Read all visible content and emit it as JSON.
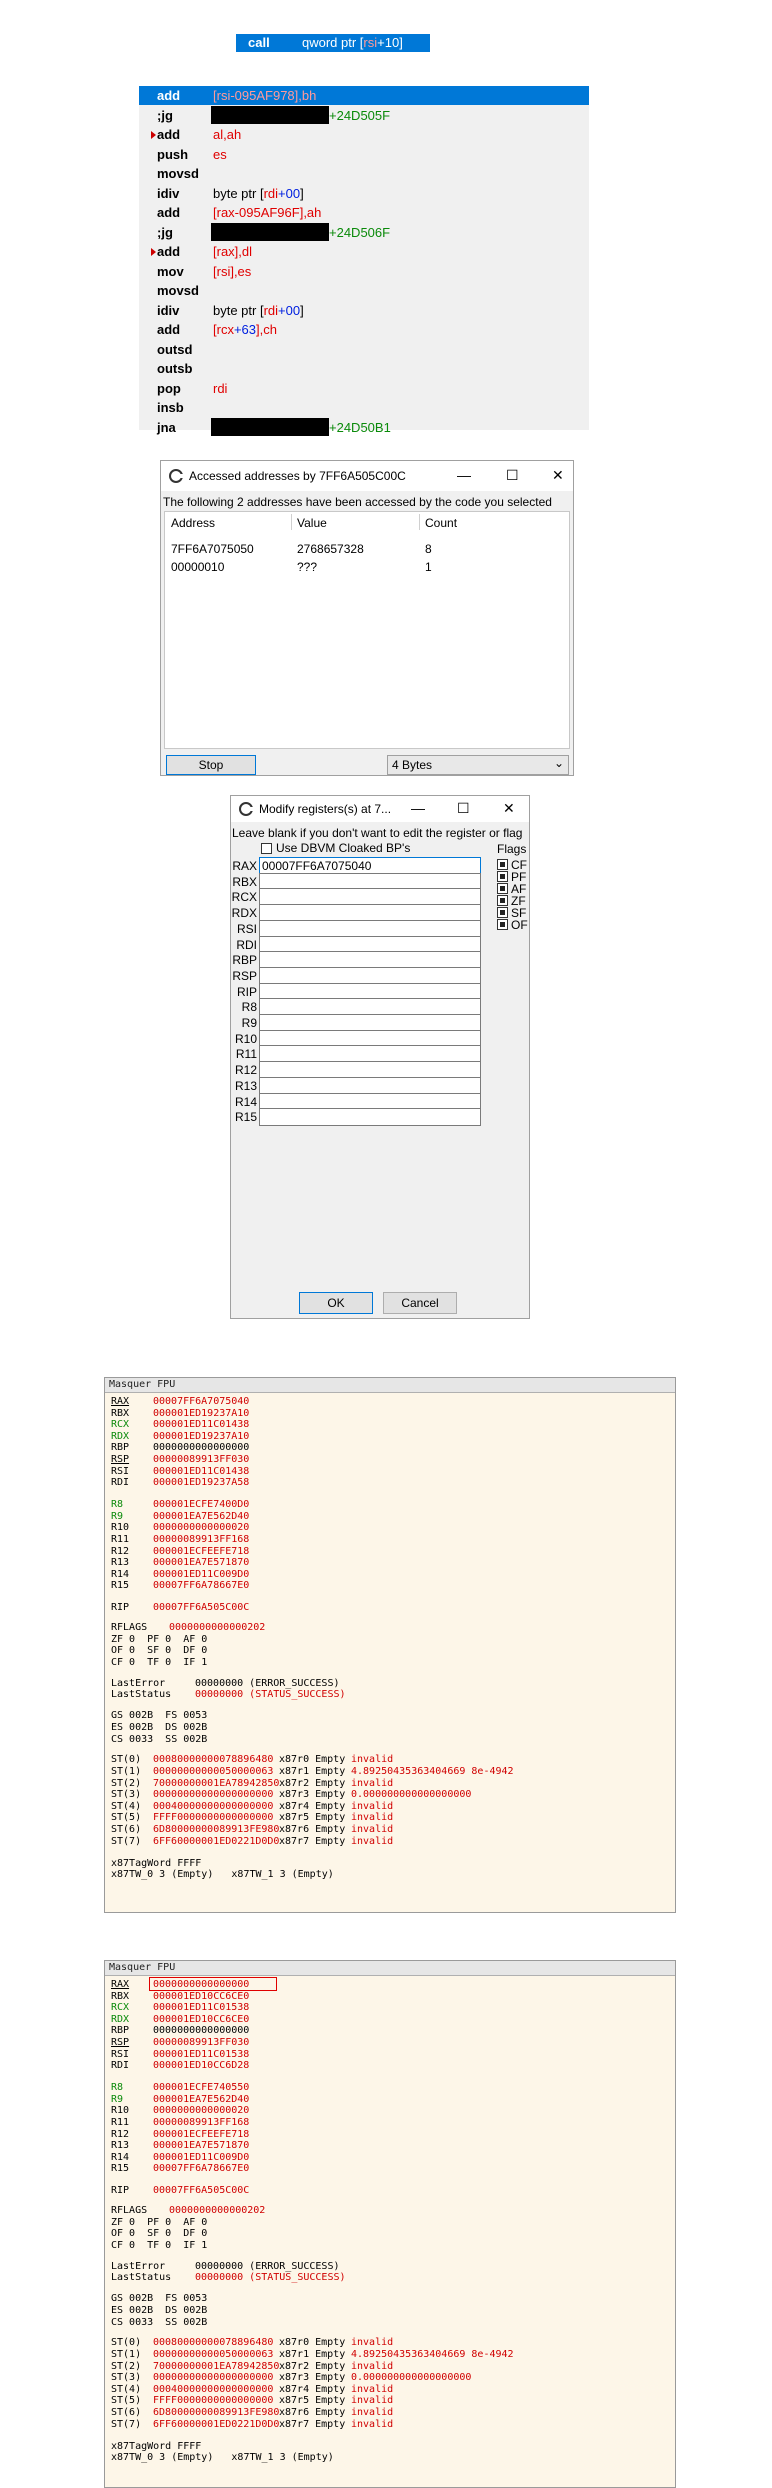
{
  "call_line": {
    "mnemonic": "call",
    "operand_prefix": "qword ptr [",
    "operand_reg": "rsi",
    "operand_plus": "+",
    "operand_off": "10",
    "operand_suffix": "]"
  },
  "disasm": [
    {
      "mn": "add",
      "ops": [
        [
          "red",
          "[rsi-095AF978],"
        ],
        [
          "red",
          "bh"
        ]
      ],
      "selected": true
    },
    {
      "mn": ";jg",
      "redacted": true,
      "target": "+24D505F",
      "arrow": false
    },
    {
      "mn": "add",
      "ops": [
        [
          "red",
          "al,ah"
        ]
      ],
      "arrow": true
    },
    {
      "mn": "push",
      "ops": [
        [
          "red",
          "es"
        ]
      ]
    },
    {
      "mn": "movsd",
      "ops": []
    },
    {
      "mn": "idiv",
      "ops": [
        [
          "",
          "byte ptr ["
        ],
        [
          "red",
          "rdi"
        ],
        [
          "blue",
          "+00"
        ],
        [
          "",
          "]"
        ]
      ]
    },
    {
      "mn": "add",
      "ops": [
        [
          "red",
          "[rax-095AF96F],ah"
        ]
      ]
    },
    {
      "mn": ";jg",
      "redacted": true,
      "target": "+24D506F"
    },
    {
      "mn": "add",
      "ops": [
        [
          "red",
          "[rax],dl"
        ]
      ],
      "arrow": true
    },
    {
      "mn": "mov",
      "ops": [
        [
          "red",
          "[rsi],es"
        ]
      ]
    },
    {
      "mn": "movsd",
      "ops": []
    },
    {
      "mn": "idiv",
      "ops": [
        [
          "",
          "byte ptr ["
        ],
        [
          "red",
          "rdi"
        ],
        [
          "blue",
          "+00"
        ],
        [
          "",
          "]"
        ]
      ]
    },
    {
      "mn": "add",
      "ops": [
        [
          "red",
          "[rcx"
        ],
        [
          "blue",
          "+63"
        ],
        [
          "red",
          "],ch"
        ]
      ]
    },
    {
      "mn": "outsd",
      "ops": []
    },
    {
      "mn": "outsb",
      "ops": []
    },
    {
      "mn": "pop",
      "ops": [
        [
          "red",
          "rdi"
        ]
      ]
    },
    {
      "mn": "insb",
      "ops": []
    },
    {
      "mn": "jna",
      "redacted": true,
      "target": "+24D50B1"
    }
  ],
  "accessed": {
    "title": "Accessed addresses by 7FF6A505C00C",
    "desc": "The following 2 addresses have been accessed by the code you selected",
    "headers": [
      "Address",
      "Value",
      "Count"
    ],
    "rows": [
      [
        "7FF6A7075050",
        "2768657328",
        "8"
      ],
      [
        "00000010",
        "???",
        "1"
      ]
    ],
    "stop_label": "Stop",
    "size_value": "4 Bytes",
    "min": "—",
    "max": "☐",
    "close": "✕"
  },
  "modify": {
    "title": "Modify registers(s) at 7...",
    "desc": "Leave blank if you don't want to edit the register or flag",
    "dbvm_label": "Use DBVM Cloaked BP's",
    "flags_title": "Flags",
    "regs": [
      "RAX",
      "RBX",
      "RCX",
      "RDX",
      "RSI",
      "RDI",
      "RBP",
      "RSP",
      "RIP",
      "R8",
      "R9",
      "R10",
      "R11",
      "R12",
      "R13",
      "R14",
      "R15"
    ],
    "rax_value": "00007FF6A7075040",
    "flags": [
      "CF",
      "PF",
      "AF",
      "ZF",
      "SF",
      "OF"
    ],
    "ok": "OK",
    "cancel": "Cancel",
    "min": "—",
    "max": "☐",
    "close": "✕"
  },
  "panel1": {
    "title": "Masquer FPU",
    "lines": [
      [
        "RAX",
        "00007FF6A7075040",
        "u"
      ],
      [
        "RBX",
        "000001ED19237A10",
        ""
      ],
      [
        "RCX",
        "000001ED11C01438",
        "g"
      ],
      [
        "RDX",
        "000001ED19237A10",
        "g"
      ],
      [
        "RBP",
        "0000000000000000",
        "k"
      ],
      [
        "RSP",
        "00000089913FF030",
        "u"
      ],
      [
        "RSI",
        "000001ED11C01438",
        ""
      ],
      [
        "RDI",
        "000001ED19237A58",
        ""
      ],
      [
        "",
        ""
      ],
      [
        "R8",
        "000001ECFE7400D0",
        "g"
      ],
      [
        "R9",
        "000001EA7E562D40",
        "g"
      ],
      [
        "R10",
        "0000000000000020",
        ""
      ],
      [
        "R11",
        "00000089913FF168",
        ""
      ],
      [
        "R12",
        "000001ECFEEFE718",
        ""
      ],
      [
        "R13",
        "000001EA7E571870",
        ""
      ],
      [
        "R14",
        "000001ED11C009D0",
        ""
      ],
      [
        "R15",
        "00007FF6A78667E0",
        ""
      ],
      [
        "",
        ""
      ],
      [
        "RIP",
        "00007FF6A505C00C",
        ""
      ]
    ],
    "rflags": "0000000000000202",
    "flagrows": [
      "ZF 0  PF 0  AF 0",
      "OF 0  SF 0  DF 0",
      "CF 0  TF 0  IF 1"
    ],
    "lasterror": "00000000 (ERROR_SUCCESS)",
    "laststatus": "00000000 (STATUS_SUCCESS)",
    "segs": [
      "GS 002B  FS 0053",
      "ES 002B  DS 002B",
      "CS 0033  SS 002B"
    ],
    "st": [
      [
        "ST(0)",
        "00080000000078896480",
        "x87r0 Empty",
        "invalid"
      ],
      [
        "ST(1)",
        "00000000000050000063",
        "x87r1 Empty",
        "4.89250435363404669 8e-4942"
      ],
      [
        "ST(2)",
        "70000000001EA78942850",
        "x87r2 Empty",
        "invalid"
      ],
      [
        "ST(3)",
        "00000000000000000000",
        "x87r3 Empty",
        "0.000000000000000000"
      ],
      [
        "ST(4)",
        "00040000000000000000",
        "x87r4 Empty",
        "invalid"
      ],
      [
        "ST(5)",
        "FFFF0000000000000000",
        "x87r5 Empty",
        "invalid"
      ],
      [
        "ST(6)",
        "6D80000000089913FE980",
        "x87r6 Empty",
        "invalid"
      ],
      [
        "ST(7)",
        "6FF60000001ED0221D0D0",
        "x87r7 Empty",
        "invalid"
      ]
    ],
    "tagword": "x87TagWord FFFF",
    "tw": "x87TW_0 3 (Empty)   x87TW_1 3 (Empty)"
  },
  "panel2": {
    "title": "Masquer FPU",
    "lines": [
      [
        "RAX",
        "0000000000000000",
        "u"
      ],
      [
        "RBX",
        "000001ED10CC6CE0",
        ""
      ],
      [
        "RCX",
        "000001ED11C01538",
        "g"
      ],
      [
        "RDX",
        "000001ED10CC6CE0",
        "g"
      ],
      [
        "RBP",
        "0000000000000000",
        "k"
      ],
      [
        "RSP",
        "00000089913FF030",
        "u"
      ],
      [
        "RSI",
        "000001ED11C01538",
        ""
      ],
      [
        "RDI",
        "000001ED10CC6D28",
        ""
      ],
      [
        "",
        ""
      ],
      [
        "R8",
        "000001ECFE740550",
        "g"
      ],
      [
        "R9",
        "000001EA7E562D40",
        "g"
      ],
      [
        "R10",
        "0000000000000020",
        ""
      ],
      [
        "R11",
        "00000089913FF168",
        ""
      ],
      [
        "R12",
        "000001ECFEEFE718",
        ""
      ],
      [
        "R13",
        "000001EA7E571870",
        ""
      ],
      [
        "R14",
        "000001ED11C009D0",
        ""
      ],
      [
        "R15",
        "00007FF6A78667E0",
        ""
      ],
      [
        "",
        ""
      ],
      [
        "RIP",
        "00007FF6A505C00C",
        ""
      ]
    ],
    "rflags": "0000000000000202",
    "flagrows": [
      "ZF 0  PF 0  AF 0",
      "OF 0  SF 0  DF 0",
      "CF 0  TF 0  IF 1"
    ],
    "lasterror": "00000000 (ERROR_SUCCESS)",
    "laststatus": "00000000 (STATUS_SUCCESS)",
    "segs": [
      "GS 002B  FS 0053",
      "ES 002B  DS 002B",
      "CS 0033  SS 002B"
    ],
    "st": [
      [
        "ST(0)",
        "00080000000078896480",
        "x87r0 Empty",
        "invalid"
      ],
      [
        "ST(1)",
        "00000000000050000063",
        "x87r1 Empty",
        "4.89250435363404669 8e-4942"
      ],
      [
        "ST(2)",
        "70000000001EA78942850",
        "x87r2 Empty",
        "invalid"
      ],
      [
        "ST(3)",
        "00000000000000000000",
        "x87r3 Empty",
        "0.000000000000000000"
      ],
      [
        "ST(4)",
        "00040000000000000000",
        "x87r4 Empty",
        "invalid"
      ],
      [
        "ST(5)",
        "FFFF0000000000000000",
        "x87r5 Empty",
        "invalid"
      ],
      [
        "ST(6)",
        "6D80000000089913FE980",
        "x87r6 Empty",
        "invalid"
      ],
      [
        "ST(7)",
        "6FF60000001ED0221D0D0",
        "x87r7 Empty",
        "invalid"
      ]
    ],
    "tagword": "x87TagWord FFFF",
    "tw": "x87TW_0 3 (Empty)   x87TW_1 3 (Empty)"
  },
  "colors": {
    "accent": "#0078d7",
    "red": "#e00000",
    "green": "#0a8a0a",
    "panel_bg": "#fdf6e8"
  }
}
